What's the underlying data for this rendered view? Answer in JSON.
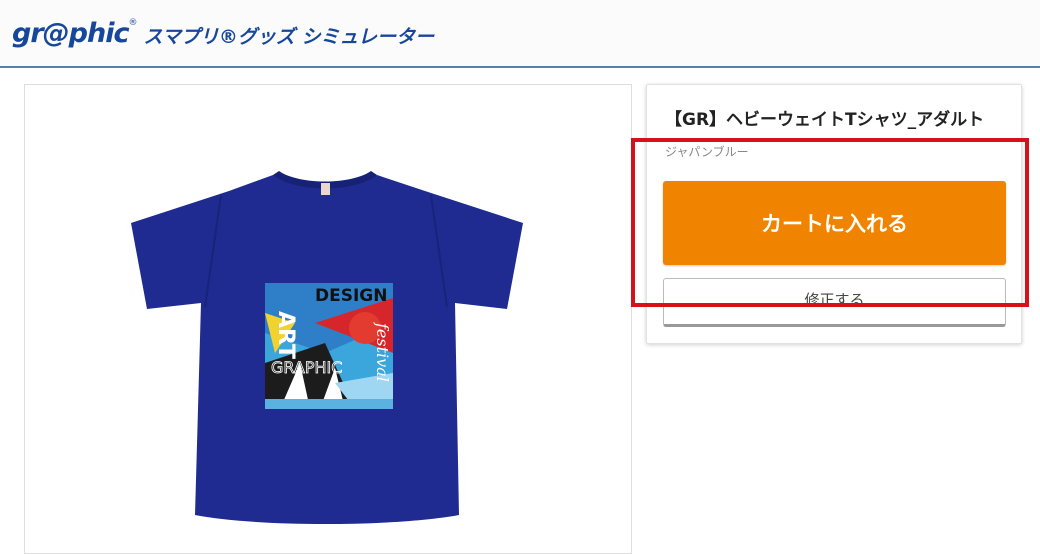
{
  "header": {
    "logo_text": "gr@phic",
    "logo_reg": "®",
    "subtitle": "スマプリ®グッズ シミュレーター"
  },
  "preview": {
    "artwork_lines": [
      "DESIGN",
      "ART",
      "GRAPHIC",
      "festival"
    ],
    "shirt_color": "#1f2b91"
  },
  "product": {
    "title": "【GR】ヘビーウェイトTシャツ_アダルト",
    "color_name": "ジャパンブルー",
    "cart_label": "カートに入れる",
    "edit_label": "修正する"
  },
  "colors": {
    "accent": "#f08300",
    "brand": "#17479b",
    "highlight": "#d7111c"
  }
}
